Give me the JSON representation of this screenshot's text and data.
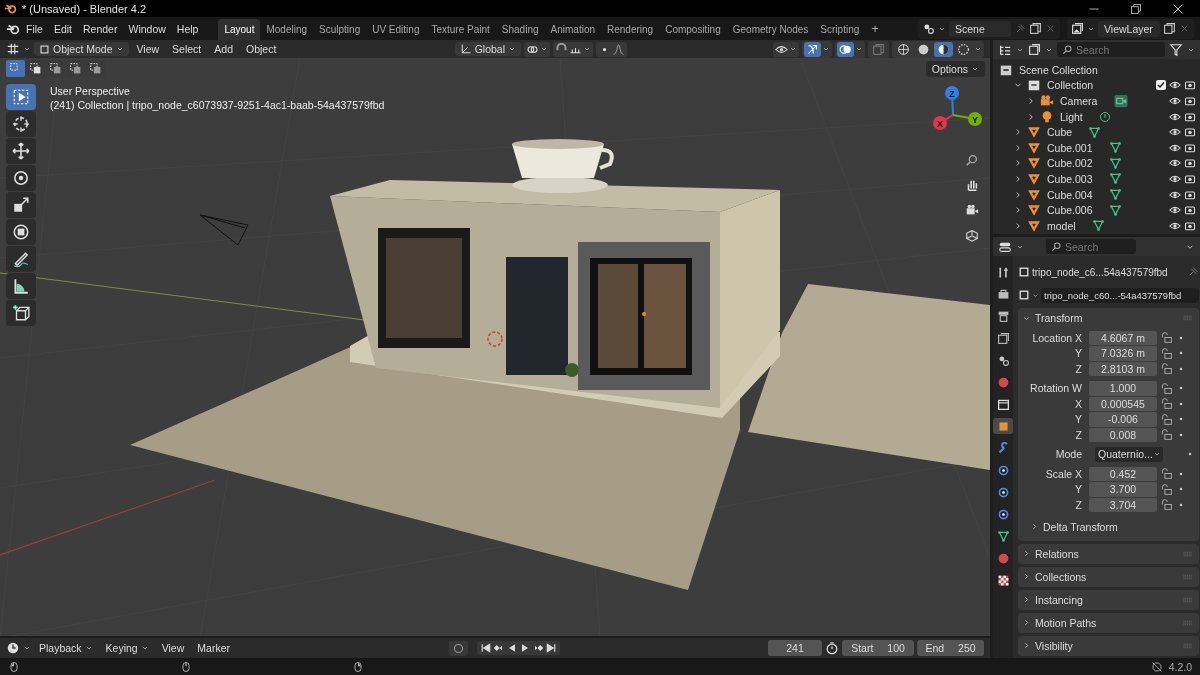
{
  "window": {
    "title": "* (Unsaved) - Blender 4.2"
  },
  "menu": [
    "File",
    "Edit",
    "Render",
    "Window",
    "Help"
  ],
  "workspaces": [
    {
      "label": "Layout",
      "selected": true
    },
    {
      "label": "Modeling",
      "selected": false
    },
    {
      "label": "Sculpting",
      "selected": false
    },
    {
      "label": "UV Editing",
      "selected": false
    },
    {
      "label": "Texture Paint",
      "selected": false
    },
    {
      "label": "Shading",
      "selected": false
    },
    {
      "label": "Animation",
      "selected": false
    },
    {
      "label": "Rendering",
      "selected": false
    },
    {
      "label": "Compositing",
      "selected": false
    },
    {
      "label": "Geometry Nodes",
      "selected": false
    },
    {
      "label": "Scripting",
      "selected": false
    }
  ],
  "add_workspace": "+",
  "scene": {
    "name": "Scene"
  },
  "view_layer": {
    "name": "ViewLayer"
  },
  "viewport": {
    "mode": "Object Mode",
    "menu": [
      "View",
      "Select",
      "Add",
      "Object"
    ],
    "orientation": "Global",
    "toggles": [
      {
        "kind": "gizmos",
        "on": true
      },
      {
        "kind": "overlays",
        "on": true
      },
      {
        "kind": "xray",
        "on": false
      }
    ],
    "shading": [
      {
        "kind": "wireframe",
        "selected": false
      },
      {
        "kind": "solid",
        "selected": false
      },
      {
        "kind": "material",
        "selected": true
      },
      {
        "kind": "rendered",
        "selected": false
      }
    ],
    "select_modes": [
      {
        "kind": "set",
        "selected": true
      },
      {
        "kind": "extend",
        "selected": false
      },
      {
        "kind": "subtract",
        "selected": false
      },
      {
        "kind": "difference",
        "selected": false
      },
      {
        "kind": "intersect",
        "selected": false
      }
    ],
    "options": "Options",
    "overlay_text": [
      "User Perspective",
      "(241) Collection | tripo_node_c6073937-9251-4ac1-baab-54a437579fbd"
    ],
    "tools": [
      {
        "kind": "select",
        "selected": true
      },
      {
        "kind": "cursor",
        "selected": false
      },
      {
        "kind": "move",
        "selected": false
      },
      {
        "kind": "rotate",
        "selected": false
      },
      {
        "kind": "scale",
        "selected": false
      },
      {
        "kind": "transform",
        "selected": false
      },
      {
        "kind": "annotate",
        "selected": false
      },
      {
        "kind": "measure",
        "selected": false
      },
      {
        "kind": "add_cube",
        "selected": false
      }
    ],
    "gizmo_axes": [
      {
        "label": "Z",
        "color": "#2f7fe8"
      },
      {
        "label": "Y",
        "color": "#6fb300"
      },
      {
        "label": "X",
        "color": "#e8334f"
      }
    ]
  },
  "outliner": {
    "search_placeholder": "Search",
    "items": [
      {
        "label": "Scene Collection",
        "kind": "scene",
        "children": [
          {
            "label": "Collection",
            "kind": "collection",
            "expanded": true,
            "checked": true,
            "children": [
              {
                "label": "Camera",
                "kind": "camera",
                "expanded": false
              },
              {
                "label": "Light",
                "kind": "light",
                "expanded": false
              }
            ]
          },
          {
            "label": "Cube",
            "kind": "mesh",
            "expanded": false
          },
          {
            "label": "Cube.001",
            "kind": "mesh",
            "expanded": false
          },
          {
            "label": "Cube.002",
            "kind": "mesh",
            "expanded": false
          },
          {
            "label": "Cube.003",
            "kind": "mesh",
            "expanded": false
          },
          {
            "label": "Cube.004",
            "kind": "mesh",
            "expanded": false
          },
          {
            "label": "Cube.006",
            "kind": "mesh",
            "expanded": false
          },
          {
            "label": "model",
            "kind": "mesh",
            "expanded": false
          }
        ]
      }
    ]
  },
  "properties": {
    "search_placeholder": "Search",
    "tabs": [
      {
        "kind": "tool",
        "selected": false
      },
      {
        "kind": "render",
        "selected": false
      },
      {
        "kind": "output",
        "selected": false
      },
      {
        "kind": "view_layer",
        "selected": false
      },
      {
        "kind": "scene",
        "selected": false
      },
      {
        "kind": "world",
        "selected": false
      },
      {
        "kind": "collection",
        "selected": false
      },
      {
        "kind": "object",
        "selected": true
      },
      {
        "kind": "modifiers",
        "selected": false
      },
      {
        "kind": "particles",
        "selected": false
      },
      {
        "kind": "physics",
        "selected": false
      },
      {
        "kind": "constraints",
        "selected": false
      },
      {
        "kind": "data",
        "selected": false
      },
      {
        "kind": "material",
        "selected": false
      },
      {
        "kind": "texture",
        "selected": false
      }
    ],
    "object_name": "tripo_node_c6...54a437579fbd",
    "data_name": "tripo_node_c60...-54a437579fbd",
    "transform": {
      "label": "Transform",
      "expanded": true,
      "groups": [
        [
          {
            "kind": "field",
            "label": "Location X",
            "value": "4.6067 m"
          },
          {
            "kind": "field",
            "label": "Y",
            "value": "7.0326 m"
          },
          {
            "kind": "field",
            "label": "Z",
            "value": "2.8103 m"
          }
        ],
        [
          {
            "kind": "field",
            "label": "Rotation W",
            "value": "1.000"
          },
          {
            "kind": "field",
            "label": "X",
            "value": "0.000545"
          },
          {
            "kind": "field",
            "label": "Y",
            "value": "-0.006"
          },
          {
            "kind": "field",
            "label": "Z",
            "value": "0.008"
          }
        ],
        [
          {
            "kind": "dropdown",
            "label": "Mode",
            "value": "Quaternio..."
          }
        ],
        [
          {
            "kind": "field",
            "label": "Scale X",
            "value": "0.452"
          },
          {
            "kind": "field",
            "label": "Y",
            "value": "3.700"
          },
          {
            "kind": "field",
            "label": "Z",
            "value": "3.704"
          }
        ]
      ],
      "subpanels": [
        {
          "label": "Delta Transform",
          "expanded": false
        }
      ]
    },
    "panels": [
      {
        "label": "Relations",
        "expanded": false
      },
      {
        "label": "Collections",
        "expanded": false
      },
      {
        "label": "Instancing",
        "expanded": false
      },
      {
        "label": "Motion Paths",
        "expanded": false
      },
      {
        "label": "Visibility",
        "expanded": false
      }
    ]
  },
  "timeline": {
    "menu": [
      {
        "label": "Playback",
        "dropdown": true
      },
      {
        "label": "Keying",
        "dropdown": true
      },
      {
        "label": "View",
        "dropdown": false
      },
      {
        "label": "Marker",
        "dropdown": false
      }
    ],
    "current_frame": "241",
    "start_label": "Start",
    "start": "100",
    "end_label": "End",
    "end": "250"
  },
  "status_bar": {
    "version": "4.2.0"
  }
}
